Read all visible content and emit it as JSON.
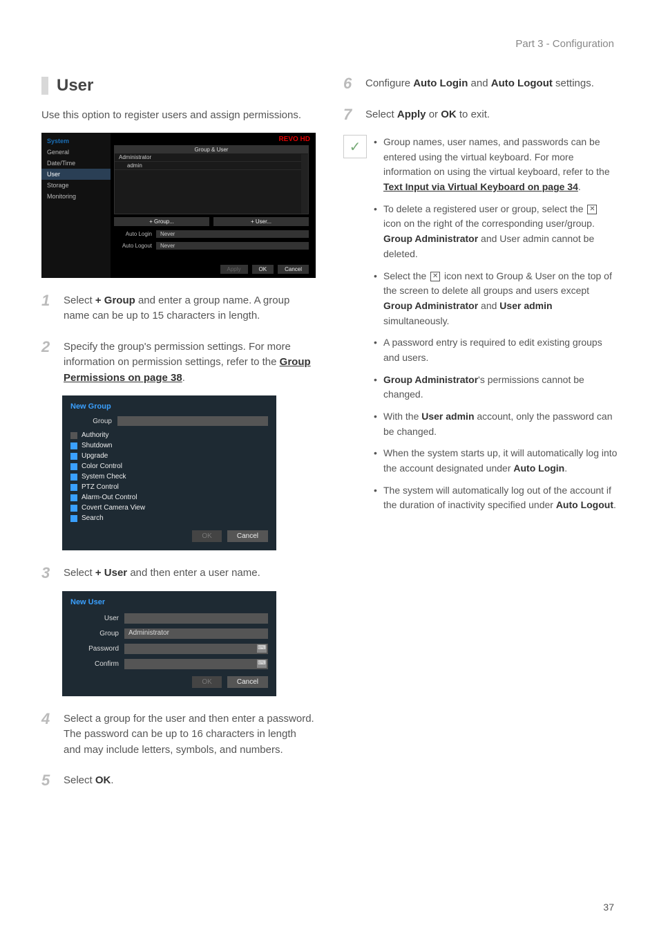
{
  "header": {
    "breadcrumb": "Part 3 - Configuration"
  },
  "section": {
    "title": "User",
    "intro": "Use this option to register users and assign permissions."
  },
  "sys": {
    "logo": "REVO HD",
    "sidebar_header": "System",
    "sidebar": [
      "General",
      "Date/Time",
      "User",
      "Storage",
      "Monitoring"
    ],
    "table_header": "Group & User",
    "rows": [
      "Administrator",
      "admin"
    ],
    "btn_group": "+ Group...",
    "btn_user": "+ User...",
    "auto_login_label": "Auto Login",
    "auto_login_value": "Never",
    "auto_logout_label": "Auto Logout",
    "auto_logout_value": "Never",
    "apply": "Apply",
    "ok": "OK",
    "cancel": "Cancel"
  },
  "steps": {
    "s1a": "Select ",
    "s1b": "+ Group",
    "s1c": " and enter a group name. A group name can be up to 15 characters in length.",
    "s2a": "Specify the group's permission settings. For more information on permission settings, refer to the ",
    "s2link": "Group Permissions on page 38",
    "s2b": ".",
    "s3a": "Select ",
    "s3b": "+ User",
    "s3c": " and then enter a user name.",
    "s4": "Select a group for the user and then enter a password. The password can be up to 16 characters in length and may include letters, symbols, and numbers.",
    "s5a": "Select ",
    "s5b": "OK",
    "s5c": ".",
    "s6a": "Configure ",
    "s6b": "Auto Login",
    "s6c": " and ",
    "s6d": "Auto Logout",
    "s6e": " settings.",
    "s7a": "Select ",
    "s7b": "Apply",
    "s7c": " or ",
    "s7d": "OK",
    "s7e": " to exit."
  },
  "ng": {
    "title": "New Group",
    "group_label": "Group",
    "items": [
      "Authority",
      "Shutdown",
      "Upgrade",
      "Color Control",
      "System Check",
      "PTZ Control",
      "Alarm-Out Control",
      "Covert Camera View",
      "Search"
    ],
    "ok": "OK",
    "cancel": "Cancel"
  },
  "nu": {
    "title": "New User",
    "user_label": "User",
    "group_label": "Group",
    "group_value": "Administrator",
    "password_label": "Password",
    "confirm_label": "Confirm",
    "ok": "OK",
    "cancel": "Cancel"
  },
  "notes": {
    "n1a": "Group names, user names, and passwords can be entered using the virtual keyboard. For more information on using the virtual keyboard, refer to the ",
    "n1link": "Text Input via Virtual Keyboard on page 34",
    "n1b": ".",
    "n2a": "To delete a registered user or group, select the ",
    "n2b": " icon on the right of the corresponding user/group. ",
    "n2c": "Group Administrator",
    "n2d": " and User admin cannot be deleted.",
    "n3a": "Select the ",
    "n3b": " icon next to Group & User on the top of the screen to delete all groups and users except ",
    "n3c": "Group Administrator",
    "n3d": " and ",
    "n3e": "User admin",
    "n3f": " simultaneously.",
    "n4": "A password entry is required to edit existing groups and users.",
    "n5a": "Group Administrator",
    "n5b": "'s permissions cannot be changed.",
    "n6a": "With the ",
    "n6b": "User admin",
    "n6c": " account, only the password can be changed.",
    "n7a": "When the system starts up, it will automatically log into the account designated under ",
    "n7b": "Auto Login",
    "n7c": ".",
    "n8a": "The system will automatically log out of the account if the duration of inactivity specified under ",
    "n8b": "Auto Logout",
    "n8c": "."
  },
  "page_number": "37"
}
